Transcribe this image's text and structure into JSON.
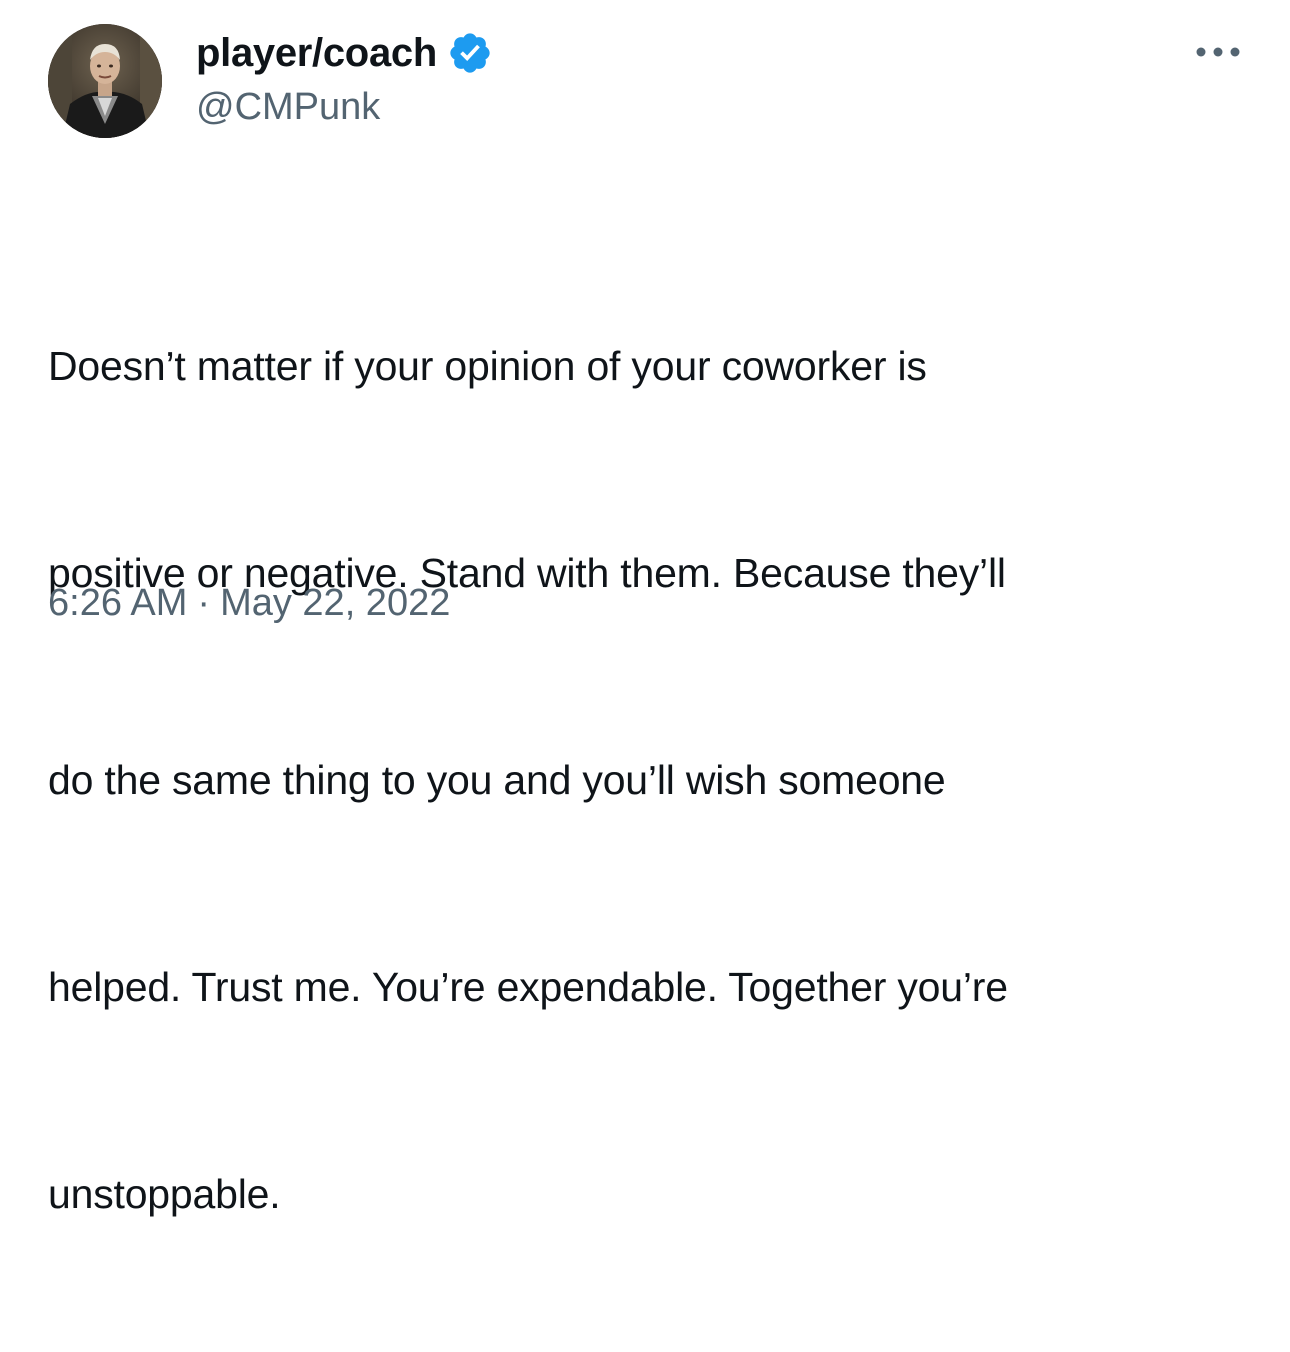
{
  "author": {
    "display_name": "player/coach",
    "handle": "@CMPunk",
    "verified": true,
    "verified_color": "#1d9bf0",
    "avatar_icon": "profile-photo"
  },
  "more_icon": "ellipsis-icon",
  "tweet": {
    "lines": [
      "Doesn’t matter if your opinion of your coworker is",
      "positive or negative. Stand with them. Because they’ll",
      "do the same thing to you and you’ll wish someone",
      "helped. Trust me. You’re expendable. Together you’re",
      "unstoppable."
    ]
  },
  "meta": {
    "time": "6:26 AM",
    "separator": "·",
    "date": "May 22, 2022"
  },
  "colors": {
    "text_primary": "#0f1419",
    "text_secondary": "#536471",
    "background": "#ffffff"
  }
}
